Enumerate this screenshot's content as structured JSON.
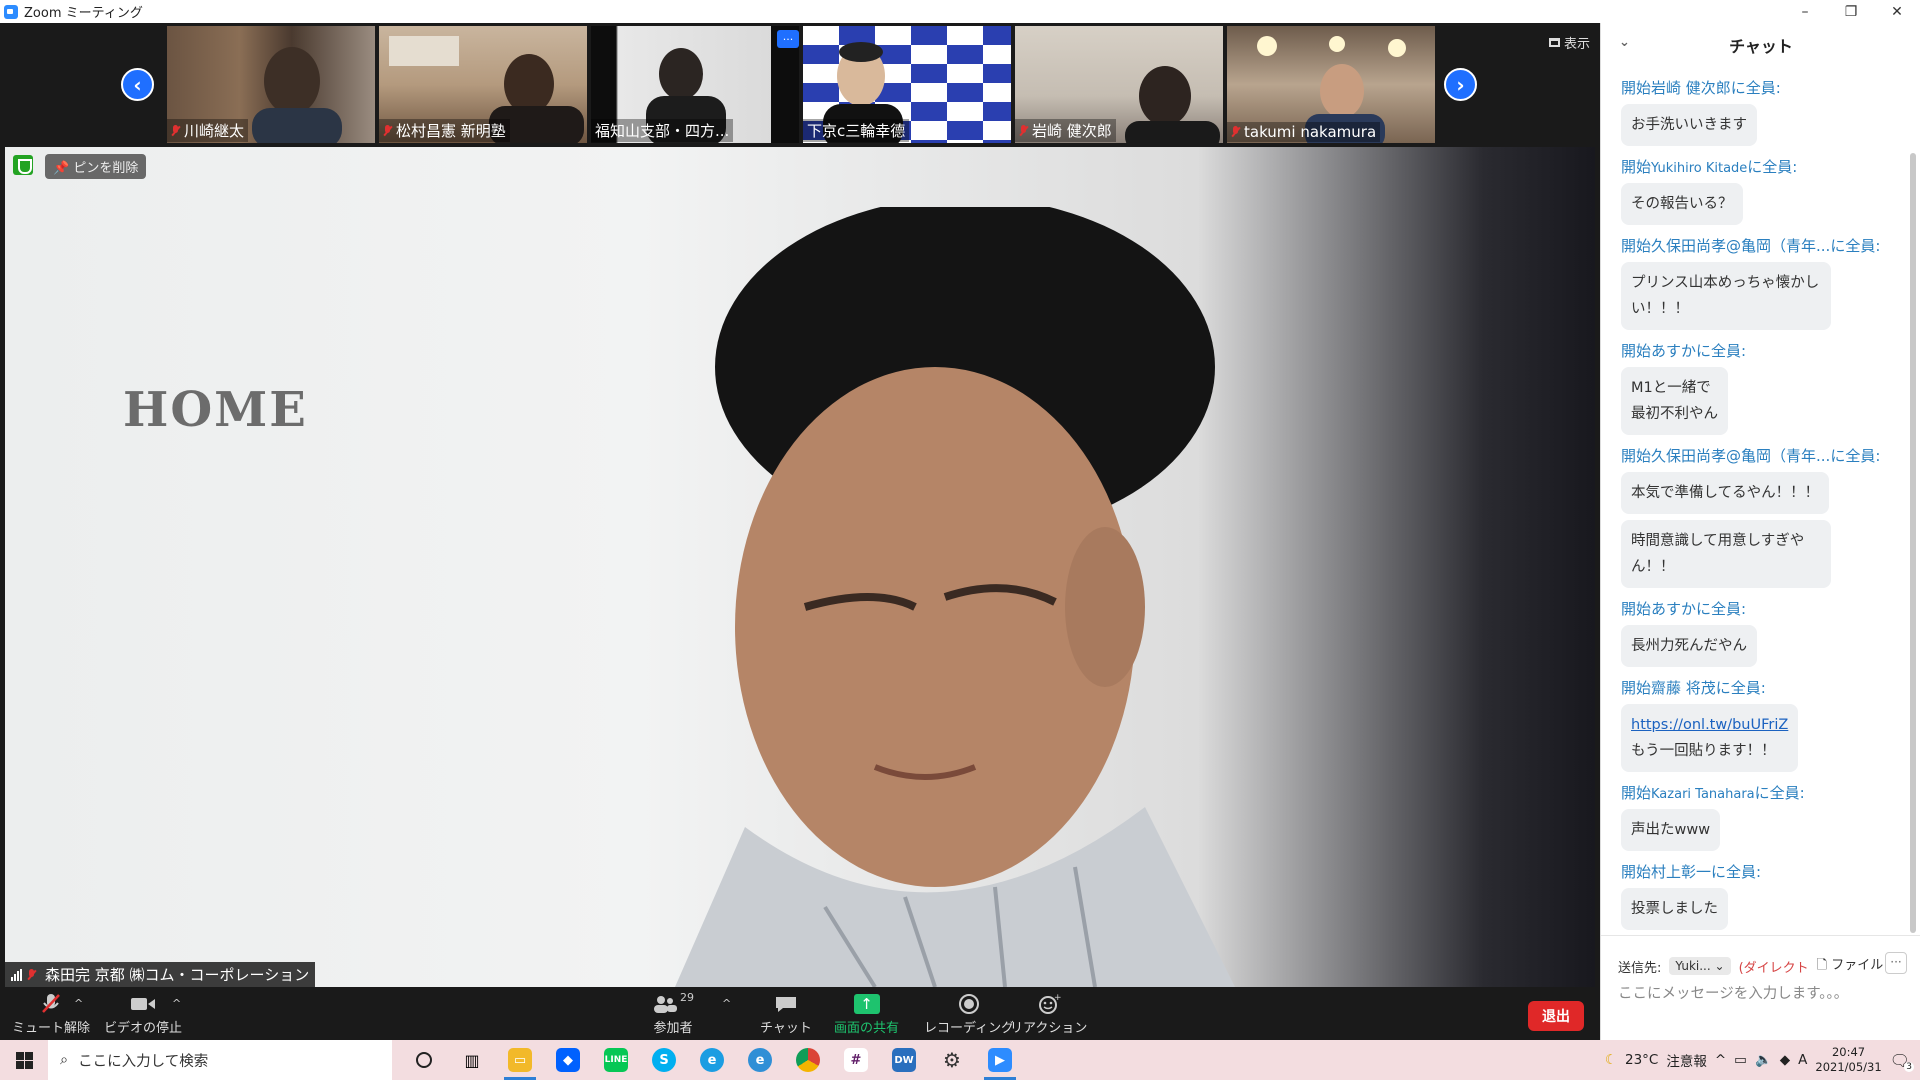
{
  "window": {
    "title": "Zoom ミーティング",
    "minimize": "–",
    "restore": "❐",
    "close": "✕"
  },
  "participants_strip": {
    "thumbnails": [
      {
        "name": "川崎継太",
        "muted": true
      },
      {
        "name": "松村昌憲 新明塾",
        "muted": true
      },
      {
        "name": "福知山支部・四方...",
        "muted": false
      },
      {
        "name": "下京c三輪幸德",
        "muted": false
      },
      {
        "name": "岩崎 健次郎",
        "muted": true
      },
      {
        "name": "takumi nakamura",
        "muted": true
      }
    ],
    "view_label": "表示",
    "more_dots": "..."
  },
  "main_video": {
    "unpin_label": "ピンを削除",
    "speaker_name": "森田完 京都 ㈱コム・コーポレーション",
    "wall_logo": "HOME"
  },
  "toolbar": {
    "unmute": "ミュート解除",
    "stop_video": "ビデオの停止",
    "participants": "参加者",
    "participant_count": "29",
    "chat": "チャット",
    "share_screen": "画面の共有",
    "recording": "レコーディング",
    "reactions": "リアクション",
    "leave": "退出"
  },
  "chat": {
    "title": "チャット",
    "messages": [
      {
        "prefix": "開始",
        "sender": "岩崎 健次郎",
        "to": "に全員:",
        "text": "お手洗いいきます"
      },
      {
        "prefix": "開始",
        "sender": "Yukihiro Kitade",
        "to": "に全員:",
        "text": "その報告いる？"
      },
      {
        "prefix": "開始",
        "sender": "久保田尚孝@亀岡（青年...",
        "to": "に全員:",
        "text": "プリンス山本めっちゃ懐かしい！！！"
      },
      {
        "prefix": "開始",
        "sender": "あすか",
        "to": "に全員:",
        "text": "M1と一緒で\n最初不利やん"
      },
      {
        "prefix": "開始",
        "sender": "久保田尚孝@亀岡（青年...",
        "to": "に全員:",
        "text": "本気で準備してるやん！！！",
        "text2": "時間意識して用意しすぎやん！！"
      },
      {
        "prefix": "開始",
        "sender": "あすか",
        "to": "に全員:",
        "text": "長州力死んだやん"
      },
      {
        "prefix": "開始",
        "sender": "齋藤 将茂",
        "to": "に全員:",
        "link": "https://onl.tw/buUFriZ",
        "text": "もう一回貼ります！！"
      },
      {
        "prefix": "開始",
        "sender": "Kazari Tanahara",
        "to": "に全員:",
        "text": "声出たwww"
      },
      {
        "prefix": "開始",
        "sender": "村上彰一",
        "to": "に全員:",
        "text": "投票しました"
      }
    ],
    "send_to_label": "送信先:",
    "send_to_value": "Yuki...",
    "direct_label": "(ダイレクト",
    "file_label": "ファイル",
    "input_placeholder": "ここにメッセージを入力します。。。"
  },
  "taskbar": {
    "search_placeholder": "ここに入力して検索",
    "weather": "23°C",
    "weather_alert": "注意報",
    "time": "20:47",
    "date": "2021/05/31",
    "ime": "A",
    "notification_count": "3"
  }
}
